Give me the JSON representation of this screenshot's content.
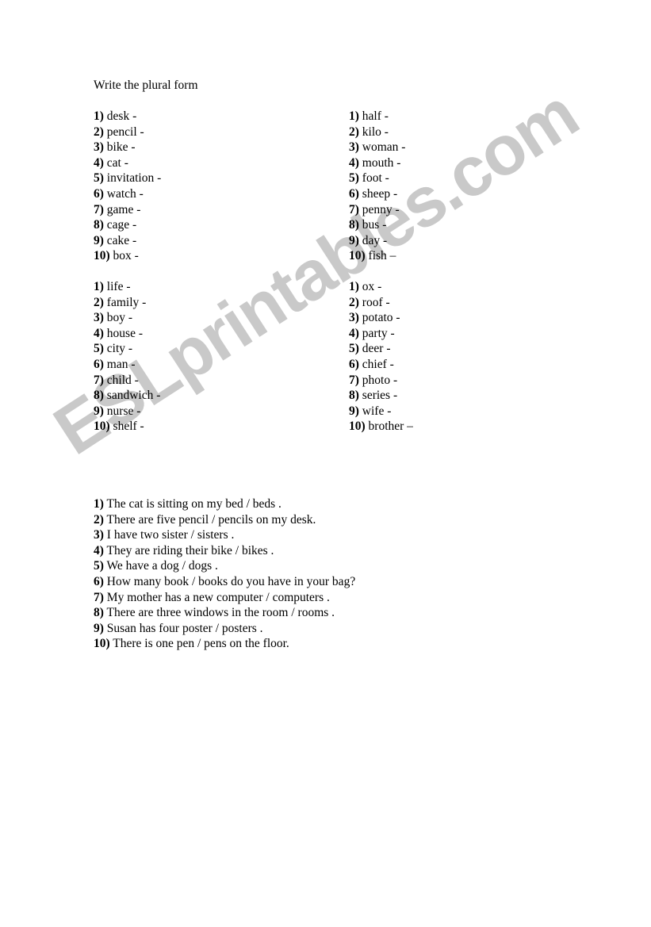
{
  "document": {
    "title": "Write the plural form"
  },
  "watermark": {
    "text": "ESLprintables.com",
    "color": "#c9c9c9"
  },
  "exercise_1": {
    "left_column": [
      {
        "num": "1)",
        "word": "desk -"
      },
      {
        "num": "2)",
        "word": "pencil -"
      },
      {
        "num": "3)",
        "word": "bike -"
      },
      {
        "num": "4)",
        "word": "cat -"
      },
      {
        "num": "5)",
        "word": "invitation -"
      },
      {
        "num": "6)",
        "word": "watch -"
      },
      {
        "num": "7)",
        "word": "game -"
      },
      {
        "num": "8)",
        "word": "cage -"
      },
      {
        "num": "9)",
        "word": "cake -"
      },
      {
        "num": "10)",
        "word": "box -"
      }
    ],
    "right_column": [
      {
        "num": "1)",
        "word": "half -"
      },
      {
        "num": "2)",
        "word": "kilo -"
      },
      {
        "num": "3)",
        "word": "woman -"
      },
      {
        "num": "4)",
        "word": "mouth -"
      },
      {
        "num": "5)",
        "word": "foot -"
      },
      {
        "num": "6)",
        "word": "sheep -"
      },
      {
        "num": "7)",
        "word": "penny -"
      },
      {
        "num": "8)",
        "word": "bus -"
      },
      {
        "num": "9)",
        "word": "day -"
      },
      {
        "num": "10)",
        "word": "fish –"
      }
    ]
  },
  "exercise_2": {
    "left_column": [
      {
        "num": "1)",
        "word": "life -"
      },
      {
        "num": "2)",
        "word": "family -"
      },
      {
        "num": "3)",
        "word": "boy -"
      },
      {
        "num": "4)",
        "word": "house -"
      },
      {
        "num": "5)",
        "word": "city -"
      },
      {
        "num": "6)",
        "word": "man -"
      },
      {
        "num": "7)",
        "word": "child -"
      },
      {
        "num": "8)",
        "word": "sandwich -"
      },
      {
        "num": "9)",
        "word": "nurse -"
      },
      {
        "num": "10)",
        "word": "shelf -"
      }
    ],
    "right_column": [
      {
        "num": "1)",
        "word": "ox -"
      },
      {
        "num": "2)",
        "word": "roof -"
      },
      {
        "num": "3)",
        "word": "potato -"
      },
      {
        "num": "4)",
        "word": "party -"
      },
      {
        "num": "5)",
        "word": "deer -"
      },
      {
        "num": "6)",
        "word": "chief -"
      },
      {
        "num": "7)",
        "word": "photo -"
      },
      {
        "num": "8)",
        "word": "series -"
      },
      {
        "num": "9)",
        "word": "wife -"
      },
      {
        "num": "10)",
        "word": "brother –"
      }
    ]
  },
  "exercise_3": {
    "sentences": [
      {
        "num": "1)",
        "text": "The cat is sitting on my   bed / beds ."
      },
      {
        "num": "2)",
        "text": "There are five   pencil / pencils on my desk."
      },
      {
        "num": "3)",
        "text": "I have two   sister / sisters ."
      },
      {
        "num": "4)",
        "text": "They are riding their   bike / bikes ."
      },
      {
        "num": "5)",
        "text": "We have a   dog / dogs ."
      },
      {
        "num": "6)",
        "text": "How many   book / books do you have in your bag?"
      },
      {
        "num": "7)",
        "text": "My mother has a new   computer / computers ."
      },
      {
        "num": "8)",
        "text": "There are three windows in the   room / rooms ."
      },
      {
        "num": "9)",
        "text": "Susan has four   poster / posters ."
      },
      {
        "num": "10)",
        "text": "There is one   pen / pens on the floor."
      }
    ]
  }
}
